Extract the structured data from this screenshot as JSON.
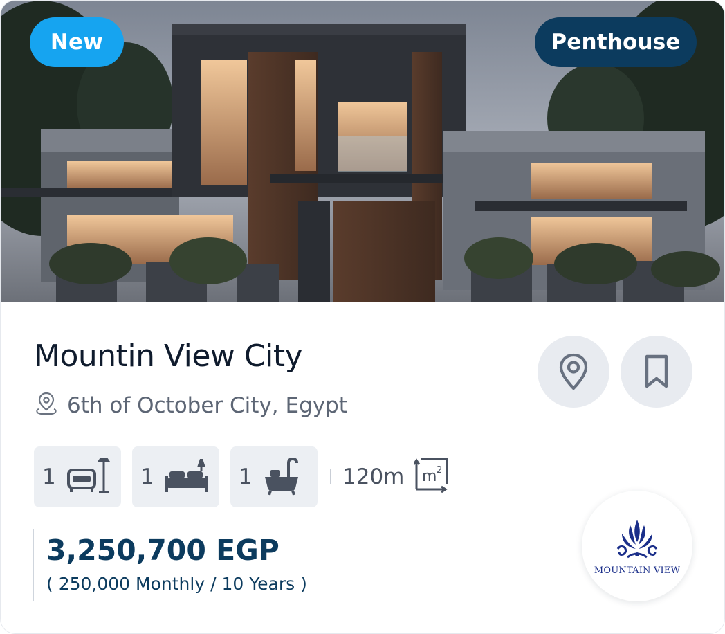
{
  "listing": {
    "badge_status": "New",
    "badge_type": "Penthouse",
    "title": "Mountin View City",
    "location": "6th of October City, Egypt",
    "features": [
      {
        "count": "1",
        "icon": "living-room-icon"
      },
      {
        "count": "1",
        "icon": "bed-icon"
      },
      {
        "count": "1",
        "icon": "bathtub-icon"
      }
    ],
    "area": "120m",
    "area_icon": "square-meter-icon",
    "price": "3,250,700 EGP",
    "installment": "( 250,000 Monthly / 10 Years )",
    "developer": "MOUNTAIN VIEW"
  },
  "colors": {
    "accent_blue": "#16a4f0",
    "navy": "#0c3b5e",
    "button_gray": "#e8ebf0",
    "feature_gray": "#eceff3",
    "developer_blue": "#1b2f8a"
  }
}
